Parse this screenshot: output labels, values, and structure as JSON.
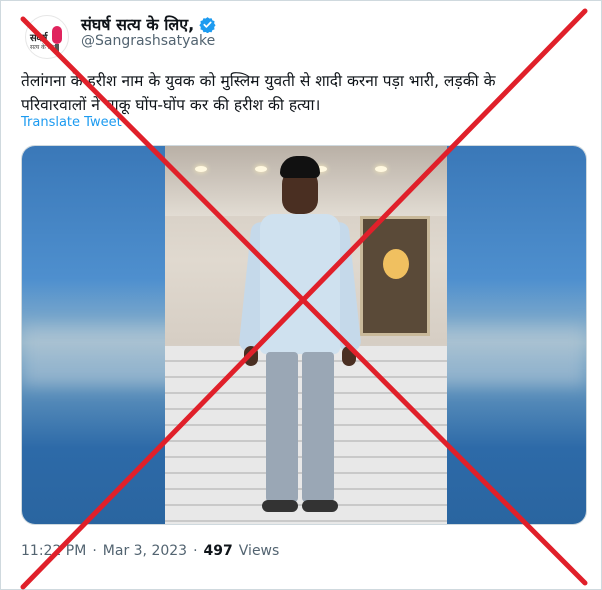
{
  "tweet": {
    "display_name": "संघर्ष सत्य के लिए,",
    "handle": "@Sangrashsatyake",
    "avatar_text": "संघर्ष",
    "avatar_sub": "सत्य के लिए",
    "text_line1": "तेलांगना के हरीश नाम के युवक को मुस्लिम युवती से शादी करना पड़ा भारी, लड़की के",
    "text_line2": "परिवारवालों ने चाकू घोंप-घोंप कर की हरीश की हत्या।",
    "translate_label": "Translate Tweet",
    "time": "11:22 PM",
    "separator": "·",
    "date": "Mar 3, 2023",
    "views_count": "497",
    "views_label": "Views"
  },
  "colors": {
    "link": "#1d9bf0",
    "verified": "#1d9bf0",
    "cross": "#e0202a",
    "muted": "#536471"
  },
  "icons": {
    "verified": "verified-badge-icon",
    "fake_stamp": "red-cross-overlay"
  }
}
